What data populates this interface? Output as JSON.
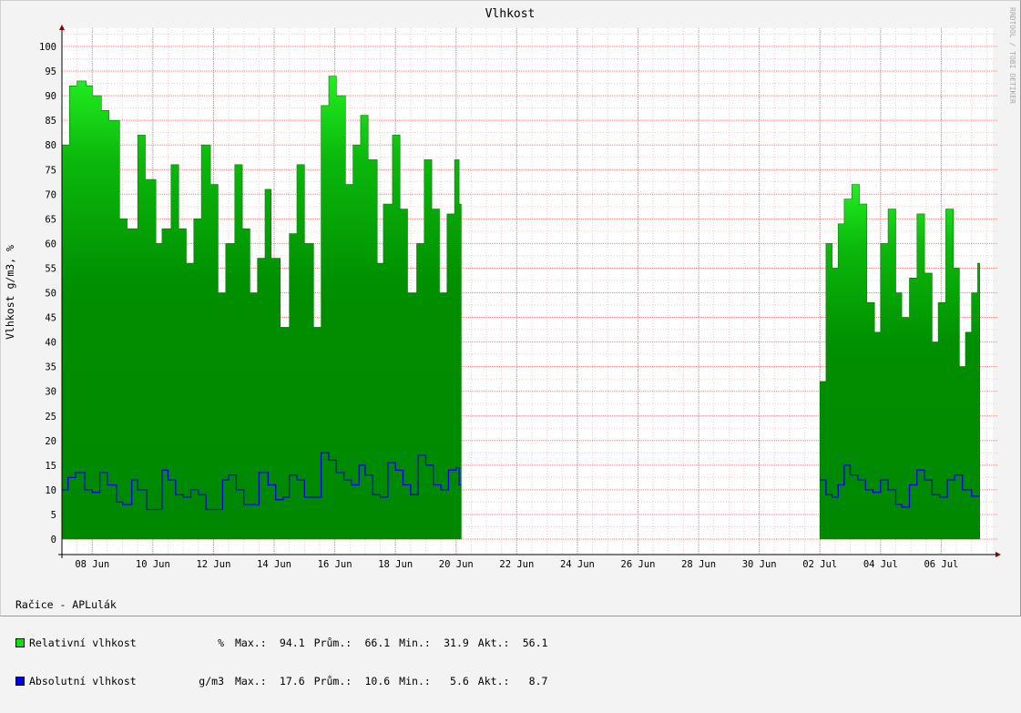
{
  "chart_data": {
    "type": "area",
    "title": "Vlhkost",
    "ylabel": "Vlhkost g/m3, %",
    "watermark": "RRDTOOL / TOBI OETIKER",
    "ylim": [
      0,
      103
    ],
    "yticks": [
      0,
      5,
      10,
      15,
      20,
      25,
      30,
      35,
      40,
      45,
      50,
      55,
      60,
      65,
      70,
      75,
      80,
      85,
      90,
      95,
      100
    ],
    "xlim_days": [
      0,
      30.7
    ],
    "xticks": [
      {
        "label": "08 Jun",
        "day": 1.0
      },
      {
        "label": "10 Jun",
        "day": 3.0
      },
      {
        "label": "12 Jun",
        "day": 5.0
      },
      {
        "label": "14 Jun",
        "day": 7.0
      },
      {
        "label": "16 Jun",
        "day": 9.0
      },
      {
        "label": "18 Jun",
        "day": 11.0
      },
      {
        "label": "20 Jun",
        "day": 13.0
      },
      {
        "label": "22 Jun",
        "day": 15.0
      },
      {
        "label": "24 Jun",
        "day": 17.0
      },
      {
        "label": "26 Jun",
        "day": 19.0
      },
      {
        "label": "28 Jun",
        "day": 21.0
      },
      {
        "label": "30 Jun",
        "day": 23.0
      },
      {
        "label": "02 Jul",
        "day": 25.0
      },
      {
        "label": "04 Jul",
        "day": 27.0
      },
      {
        "label": "06 Jul",
        "day": 29.0
      }
    ],
    "series": [
      {
        "name": "Relativní vlhkost",
        "color": "#11dd11",
        "fill_color": "#008f00",
        "segments": [
          {
            "x": [
              0.0,
              0.25,
              0.5,
              0.8,
              1.0,
              1.3,
              1.55,
              1.9,
              2.15,
              2.5,
              2.75,
              3.1,
              3.3,
              3.6,
              3.85,
              4.1,
              4.35,
              4.6,
              4.9,
              5.15,
              5.4,
              5.7,
              5.95,
              6.2,
              6.45,
              6.7,
              6.9,
              7.2,
              7.5,
              7.75,
              8.0,
              8.3,
              8.55,
              8.8,
              9.05,
              9.35,
              9.6,
              9.85,
              10.1,
              10.4,
              10.6,
              10.9,
              11.15,
              11.4,
              11.7,
              11.95,
              12.2,
              12.45,
              12.7,
              12.95,
              13.1
            ],
            "y": [
              80,
              92,
              93,
              92,
              90,
              87,
              85,
              65,
              63,
              82,
              73,
              60,
              63,
              76,
              63,
              56,
              65,
              80,
              72,
              50,
              60,
              76,
              63,
              50,
              57,
              71,
              57,
              43,
              62,
              76,
              60,
              43,
              88,
              94,
              90,
              72,
              80,
              86,
              77,
              56,
              68,
              82,
              67,
              50,
              60,
              77,
              67,
              50,
              66,
              77,
              68
            ]
          },
          {
            "x": [
              25.0,
              25.2,
              25.4,
              25.6,
              25.8,
              26.05,
              26.3,
              26.55,
              26.8,
              27.0,
              27.25,
              27.5,
              27.7,
              27.95,
              28.2,
              28.45,
              28.7,
              28.9,
              29.15,
              29.4,
              29.6,
              29.8,
              30.0,
              30.2
            ],
            "y": [
              32,
              60,
              55,
              64,
              69,
              72,
              68,
              48,
              42,
              60,
              67,
              50,
              45,
              53,
              66,
              54,
              40,
              48,
              67,
              55,
              35,
              42,
              50,
              56
            ]
          }
        ]
      },
      {
        "name": "Absolutní vlhkost",
        "color": "#0000ee",
        "segments": [
          {
            "x": [
              0.0,
              0.2,
              0.45,
              0.75,
              1.0,
              1.25,
              1.5,
              1.8,
              2.0,
              2.3,
              2.5,
              2.8,
              3.05,
              3.3,
              3.5,
              3.75,
              4.0,
              4.25,
              4.5,
              4.75,
              5.0,
              5.3,
              5.5,
              5.75,
              6.0,
              6.25,
              6.5,
              6.8,
              7.05,
              7.3,
              7.5,
              7.75,
              8.0,
              8.3,
              8.55,
              8.8,
              9.05,
              9.3,
              9.55,
              9.8,
              10.0,
              10.25,
              10.5,
              10.75,
              11.0,
              11.25,
              11.5,
              11.75,
              12.0,
              12.25,
              12.5,
              12.75,
              13.0,
              13.1
            ],
            "y": [
              10,
              12.5,
              13.5,
              10,
              9.5,
              13.5,
              11,
              7.5,
              7,
              12,
              10,
              6,
              6,
              14,
              12,
              9,
              8.5,
              10,
              9,
              6,
              6,
              12,
              13,
              10,
              7,
              7,
              13.5,
              11,
              8,
              8.5,
              13,
              12,
              8.5,
              8.5,
              17.5,
              16,
              13.5,
              12,
              11,
              15,
              13,
              9,
              8.5,
              15.5,
              14,
              11,
              9,
              17,
              15,
              11,
              10,
              14,
              14.5,
              11
            ]
          },
          {
            "x": [
              25.0,
              25.2,
              25.4,
              25.6,
              25.8,
              26.0,
              26.25,
              26.5,
              26.75,
              27.0,
              27.25,
              27.5,
              27.7,
              27.95,
              28.2,
              28.45,
              28.7,
              28.95,
              29.2,
              29.45,
              29.7,
              30.0,
              30.2
            ],
            "y": [
              12,
              9,
              8.5,
              11,
              15,
              13,
              12,
              10,
              9.5,
              12,
              10,
              7,
              6.5,
              11,
              14,
              12,
              9,
              8.5,
              12,
              13,
              10,
              8.7,
              8.7
            ]
          }
        ]
      }
    ]
  },
  "legend": {
    "station": "Račice - APLulák",
    "rows": [
      {
        "name": "Relativní vlhkost",
        "unit": "%",
        "max_label": "Max.:",
        "max": "94.1",
        "avg_label": "Prům.:",
        "avg": "66.1",
        "min_label": "Min.:",
        "min": "31.9",
        "cur_label": "Akt.:",
        "cur": "56.1",
        "color": "#11dd11"
      },
      {
        "name": "Absolutní vlhkost",
        "unit": "g/m3",
        "max_label": "Max.:",
        "max": "17.6",
        "avg_label": "Prům.:",
        "avg": "10.6",
        "min_label": "Min.:",
        "min": "5.6",
        "cur_label": "Akt.:",
        "cur": "8.7",
        "color": "#0000ee"
      }
    ]
  }
}
